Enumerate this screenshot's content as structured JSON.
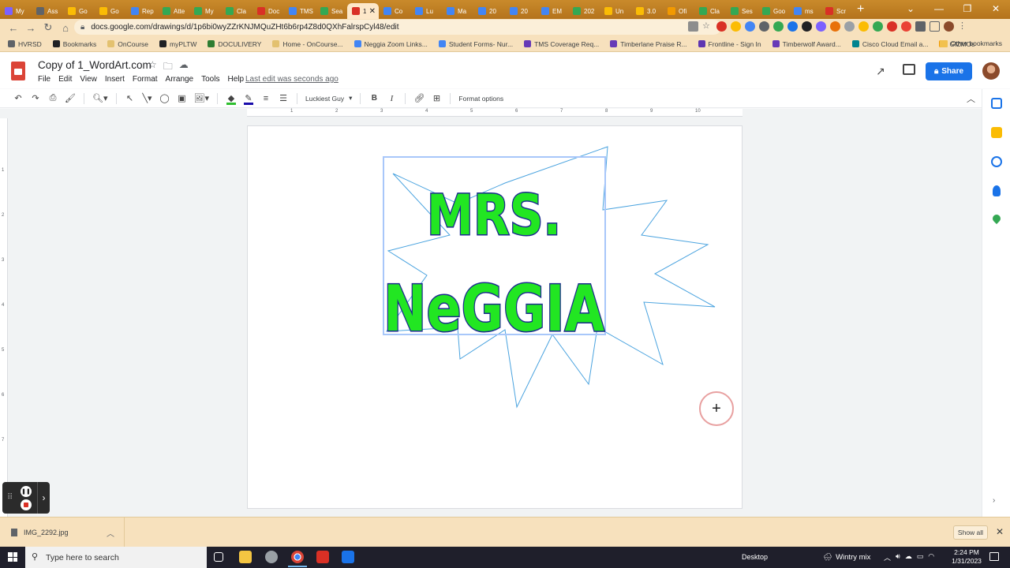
{
  "browser": {
    "tabs": [
      {
        "label": "My",
        "color": "#7b61ff"
      },
      {
        "label": "Ass",
        "color": "#5f6368"
      },
      {
        "label": "Go",
        "color": "#fbbc04"
      },
      {
        "label": "Go",
        "color": "#fbbc04"
      },
      {
        "label": "Rep",
        "color": "#4285f4"
      },
      {
        "label": "Atte",
        "color": "#34a853"
      },
      {
        "label": "My",
        "color": "#34a853"
      },
      {
        "label": "Cla",
        "color": "#34a853"
      },
      {
        "label": "Doc",
        "color": "#d93025"
      },
      {
        "label": "TMS",
        "color": "#4285f4"
      },
      {
        "label": "Sea",
        "color": "#34a853"
      },
      {
        "label": "1",
        "color": "#d93025",
        "active": true
      },
      {
        "label": "Co",
        "color": "#4285f4"
      },
      {
        "label": "Lu",
        "color": "#4285f4"
      },
      {
        "label": "Ma",
        "color": "#4285f4"
      },
      {
        "label": "20",
        "color": "#4285f4"
      },
      {
        "label": "20",
        "color": "#4285f4"
      },
      {
        "label": "EM",
        "color": "#4285f4"
      },
      {
        "label": "202",
        "color": "#34a853"
      },
      {
        "label": "Un",
        "color": "#fbbc04"
      },
      {
        "label": "3.0",
        "color": "#fbbc04"
      },
      {
        "label": "Ofi",
        "color": "#f29900"
      },
      {
        "label": "Cla",
        "color": "#34a853"
      },
      {
        "label": "Ses",
        "color": "#34a853"
      },
      {
        "label": "Goo",
        "color": "#34a853"
      },
      {
        "label": "ms",
        "color": "#4285f4"
      },
      {
        "label": "Scr",
        "color": "#d93025"
      }
    ],
    "url": "docs.google.com/drawings/d/1p6bi0wyZZrKNJMQuZHt6b6rp4Z8d0QXhFalrspCyl48/edit",
    "bookmarks": [
      {
        "label": "HVRSD",
        "color": "#5f6368"
      },
      {
        "label": "Bookmarks",
        "color": "#202124"
      },
      {
        "label": "OnCourse",
        "color": "#e3c16f"
      },
      {
        "label": "myPLTW",
        "color": "#202124"
      },
      {
        "label": "DOCULIVERY",
        "color": "#2e7d32"
      },
      {
        "label": "Home - OnCourse...",
        "color": "#e3c16f"
      },
      {
        "label": "Neggia Zoom Links...",
        "color": "#4285f4"
      },
      {
        "label": "Student Forms- Nur...",
        "color": "#4285f4"
      },
      {
        "label": "TMS Coverage Req...",
        "color": "#673ab7"
      },
      {
        "label": "Timberlane Praise R...",
        "color": "#673ab7"
      },
      {
        "label": "Frontline - Sign In",
        "color": "#5e35b1"
      },
      {
        "label": "Timberwolf Award...",
        "color": "#673ab7"
      },
      {
        "label": "Cisco Cloud Email a...",
        "color": "#00838f"
      },
      {
        "label": "GIZMOs",
        "color": "#f29900"
      }
    ],
    "other_bookmarks": "Other bookmarks"
  },
  "app": {
    "title": "Copy of 1_WordArt.com",
    "menus": [
      "File",
      "Edit",
      "View",
      "Insert",
      "Format",
      "Arrange",
      "Tools",
      "Help"
    ],
    "last_edit": "Last edit was seconds ago",
    "share_label": "Share"
  },
  "toolbar": {
    "font": "Luckiest Guy",
    "bold": "B",
    "italic": "I",
    "format_options": "Format options",
    "fill_color": "#2fbf2f",
    "line_color": "#1a0dab"
  },
  "ruler": {
    "h_labels": [
      "1",
      "2",
      "3",
      "4",
      "5",
      "6",
      "7",
      "8",
      "9",
      "10"
    ],
    "v_labels": [
      "1",
      "2",
      "3",
      "4",
      "5",
      "6",
      "7"
    ]
  },
  "drawing": {
    "line1": "MRS.",
    "line2": "NeGGIA",
    "text_fill": "#22e622",
    "text_outline": "#1b2a8f",
    "star_stroke": "#4aa3df"
  },
  "downloads": {
    "file": "IMG_2292.jpg",
    "show_all": "Show all"
  },
  "taskbar": {
    "search_placeholder": "Type here to search",
    "desktop": "Desktop",
    "weather": "Wintry mix",
    "time": "2:24 PM",
    "date": "1/31/2023"
  }
}
